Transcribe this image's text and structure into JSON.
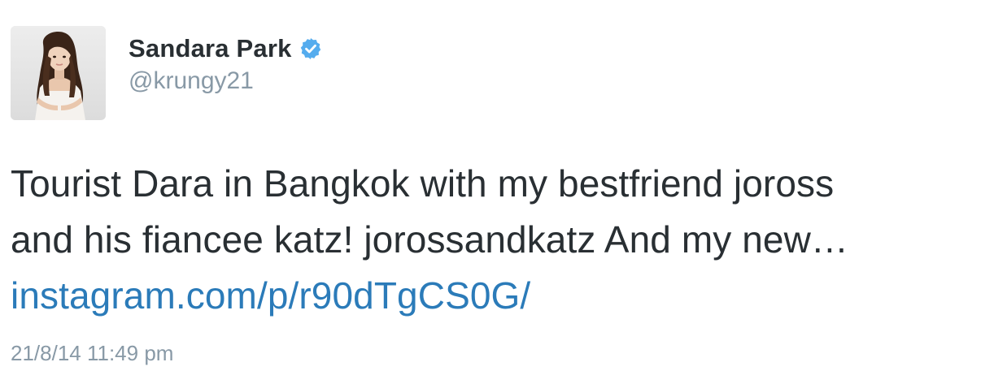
{
  "tweet": {
    "display_name": "Sandara Park",
    "verified": true,
    "verified_icon": "verified-badge-icon",
    "handle": "@krungy21",
    "avatar": "profile-photo",
    "text_lines": [
      "Tourist Dara in Bangkok with my bestfriend joross",
      "and his fiancee katz! jorossandkatz And my new…"
    ],
    "link_text": "instagram.com/p/r90dTgCS0G/",
    "timestamp": "21/8/14 11:49 pm"
  },
  "colors": {
    "text": "#292f33",
    "muted": "#8899a6",
    "link": "#2b7bb9",
    "verified_badge": "#55acee"
  }
}
